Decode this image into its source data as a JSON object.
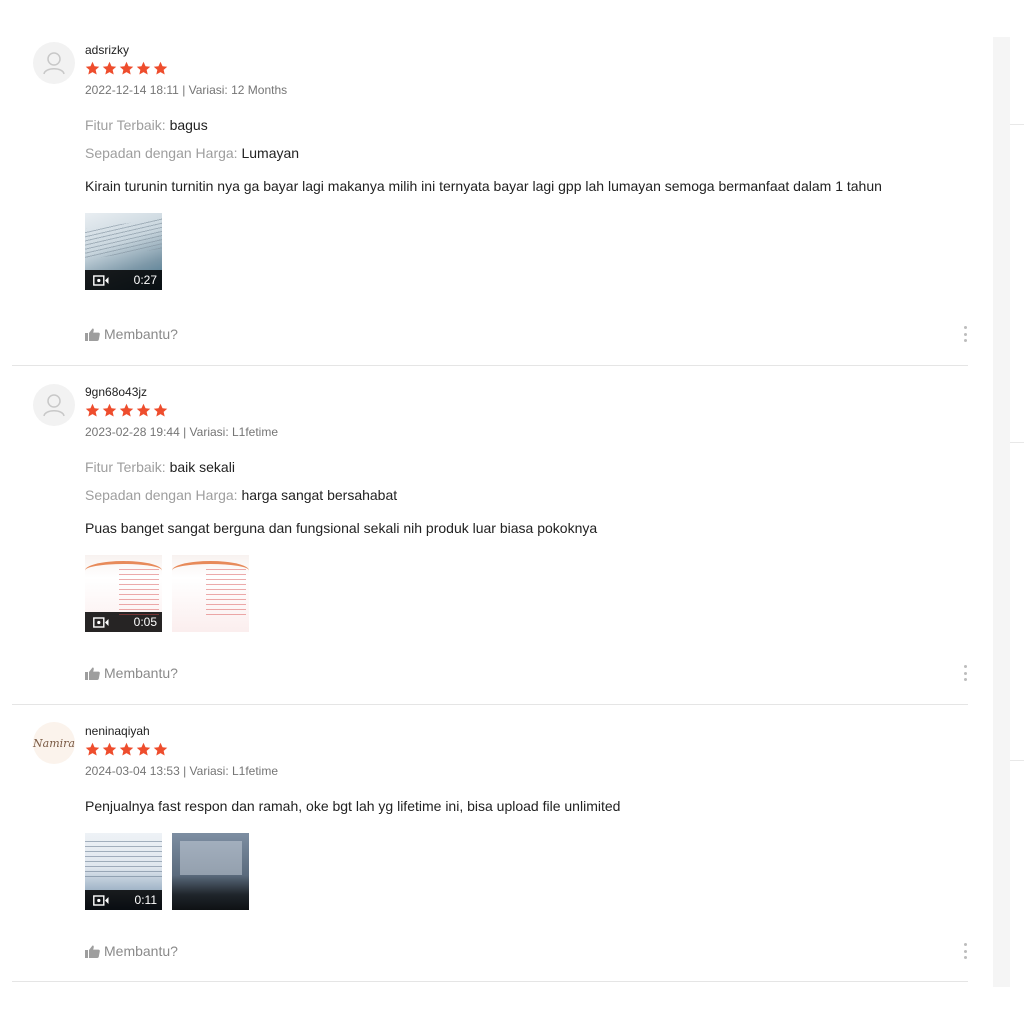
{
  "colors": {
    "star": "#ee4d2d",
    "label": "#9e9e9e",
    "meta": "#757575"
  },
  "reviews": [
    {
      "username": "adsrizky",
      "rating": 5,
      "meta": "2022-12-14 18:11 | Variasi: 12 Months",
      "fields": [
        {
          "label": "Fitur Terbaik:",
          "value": "bagus"
        },
        {
          "label": "Sepadan dengan Harga:",
          "value": "Lumayan"
        }
      ],
      "comment": "Kirain turunin turnitin nya ga bayar lagi makanya milih ini  ternyata bayar lagi gpp lah lumayan semoga bermanfaat dalam 1 tahun",
      "video_duration": "0:27",
      "helpful": "Membantu?"
    },
    {
      "username": "9gn68o43jz",
      "rating": 5,
      "meta": "2023-02-28 19:44 | Variasi: L1fetime",
      "fields": [
        {
          "label": "Fitur Terbaik:",
          "value": "baik sekali"
        },
        {
          "label": "Sepadan dengan Harga:",
          "value": "harga sangat bersahabat"
        }
      ],
      "comment": "Puas banget sangat berguna dan fungsional sekali nih produk luar biasa pokoknya",
      "video_duration": "0:05",
      "helpful": "Membantu?"
    },
    {
      "username": "neninaqiyah",
      "avatar_text": "Namira",
      "rating": 5,
      "meta": "2024-03-04 13:53 | Variasi: L1fetime",
      "comment": "Penjualnya fast respon dan ramah, oke bgt lah yg lifetime ini, bisa upload file unlimited",
      "video_duration": "0:11",
      "helpful": "Membantu?"
    }
  ]
}
